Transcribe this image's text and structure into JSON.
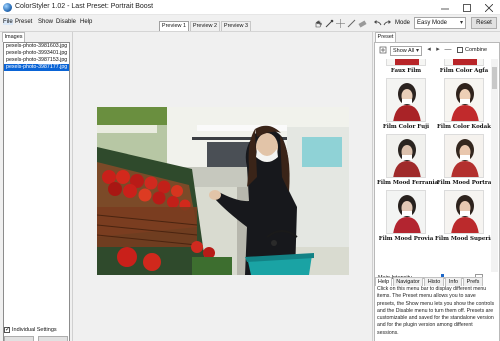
{
  "window": {
    "title": "ColorStyler 1.02 - Last Preset: Portrait Boost",
    "minimize_icon": "minimize-icon",
    "maximize_icon": "maximize-icon",
    "close_icon": "close-icon"
  },
  "menu": [
    "File",
    "Preset",
    "Show",
    "Disable",
    "Help"
  ],
  "preview_tabs": [
    "Preview 1",
    "Preview 2",
    "Preview 3"
  ],
  "toolbar": {
    "tools": [
      "hand-icon",
      "eyedropper-icon",
      "crosshair-icon",
      "pencil-icon",
      "erase-icon"
    ],
    "undo_icon": "undo-icon",
    "redo_icon": "redo-icon",
    "mode_label": "Mode",
    "mode_value": "Easy Mode",
    "reset_label": "Reset"
  },
  "images_panel": {
    "tab_label": "Images",
    "items": [
      "pexels-photo-3981603.jpg",
      "pexels-photo-3993401.jpg",
      "pexels-photo-3987153.jpg",
      "pexels-photo-3987177.jpg"
    ],
    "selected_index": 3,
    "individual_settings_label": "Individual Settings",
    "individual_settings_checked": true
  },
  "preset_panel": {
    "tab_label": "Preset",
    "show_value": "Show All",
    "combine_label": "Combine",
    "presets": [
      "Faux Film",
      "Film Color Agfa",
      "Film Color Fuji",
      "Film Color Kodak",
      "Film Mood Ferrania",
      "Film Mood Portra",
      "Film Mood Provia",
      "Film Mood Superia"
    ],
    "main_intensity_label": "Main Intensity",
    "main_intensity": 0.55
  },
  "help_panel": {
    "tabs": [
      "Help",
      "Navigator",
      "Histo",
      "Info",
      "Prefs"
    ],
    "active_tab": "Help",
    "text": "Click on this menu bar to display different menu items. The Preset menu allows you to save presets, the Show menu lets you show the controls and the Disable menu to turn them off. Presets are customizable and saved for the standalone version and for the plugin version among different sessions."
  },
  "colors": {
    "accent": "#0a64d6",
    "subject_coat": "#17181c",
    "tomato": "#c9201a"
  }
}
